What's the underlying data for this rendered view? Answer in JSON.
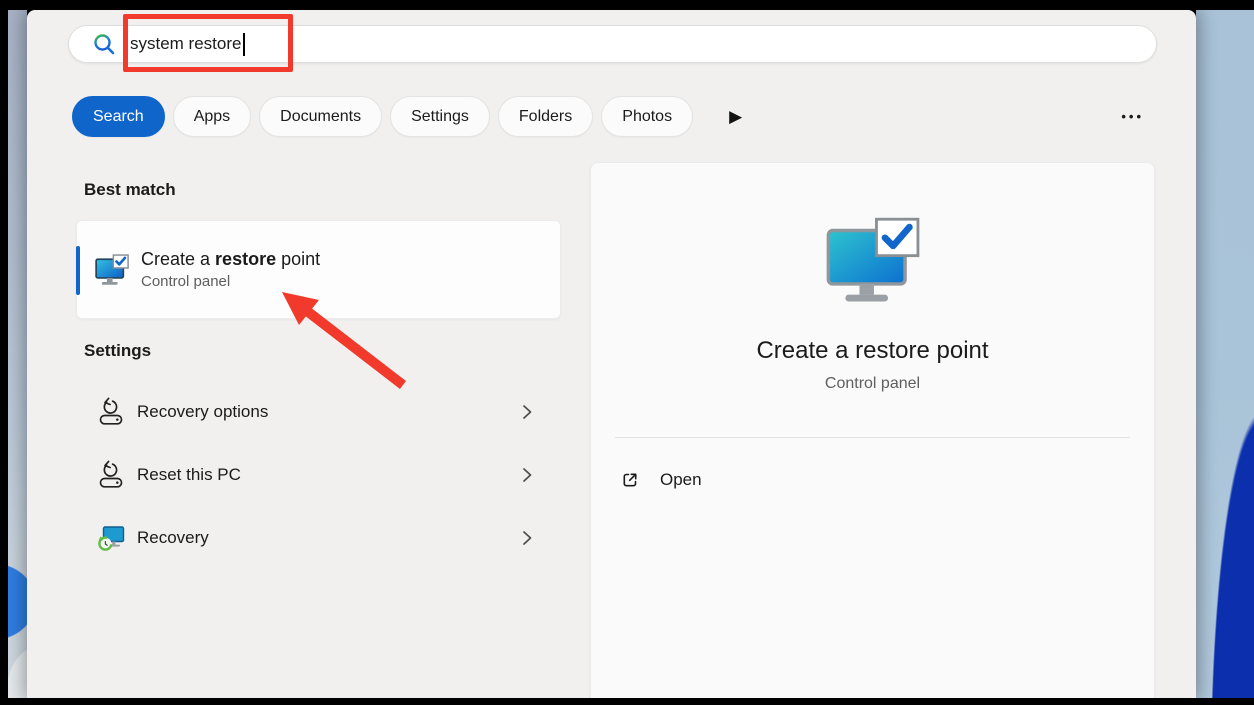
{
  "search_bar": {
    "query": "system restore",
    "icon": "search-icon"
  },
  "filter_tabs": {
    "tabs": [
      {
        "label": "Search",
        "active": true
      },
      {
        "label": "Apps",
        "active": false
      },
      {
        "label": "Documents",
        "active": false
      },
      {
        "label": "Settings",
        "active": false
      },
      {
        "label": "Folders",
        "active": false
      },
      {
        "label": "Photos",
        "active": false
      }
    ],
    "icons": {
      "play": "▶",
      "ellipsis": "•••"
    }
  },
  "best_match": {
    "heading": "Best match",
    "item": {
      "title_prefix": "Create a ",
      "title_bold": "restore",
      "title_suffix": " point",
      "subtitle": "Control panel",
      "icon": "restore-point-monitor-icon"
    }
  },
  "settings_results": {
    "heading": "Settings",
    "items": [
      {
        "label": "Recovery options",
        "icon": "reset-drive-icon"
      },
      {
        "label": "Reset this PC",
        "icon": "reset-drive-icon"
      },
      {
        "label": "Recovery",
        "icon": "recovery-monitor-icon"
      }
    ]
  },
  "preview": {
    "title": "Create a restore point",
    "subtitle": "Control panel",
    "open_label": "Open",
    "icon": "restore-point-monitor-icon"
  },
  "annotations": {
    "color": "#f13a2c",
    "shapes": [
      {
        "type": "rectangle",
        "over": "search-query"
      },
      {
        "type": "arrow",
        "pointing_to": "best-match-item"
      }
    ]
  },
  "colors": {
    "accent": "#1065cb",
    "flyout_background": "#f1f0ef",
    "card_background": "#fafafa"
  }
}
